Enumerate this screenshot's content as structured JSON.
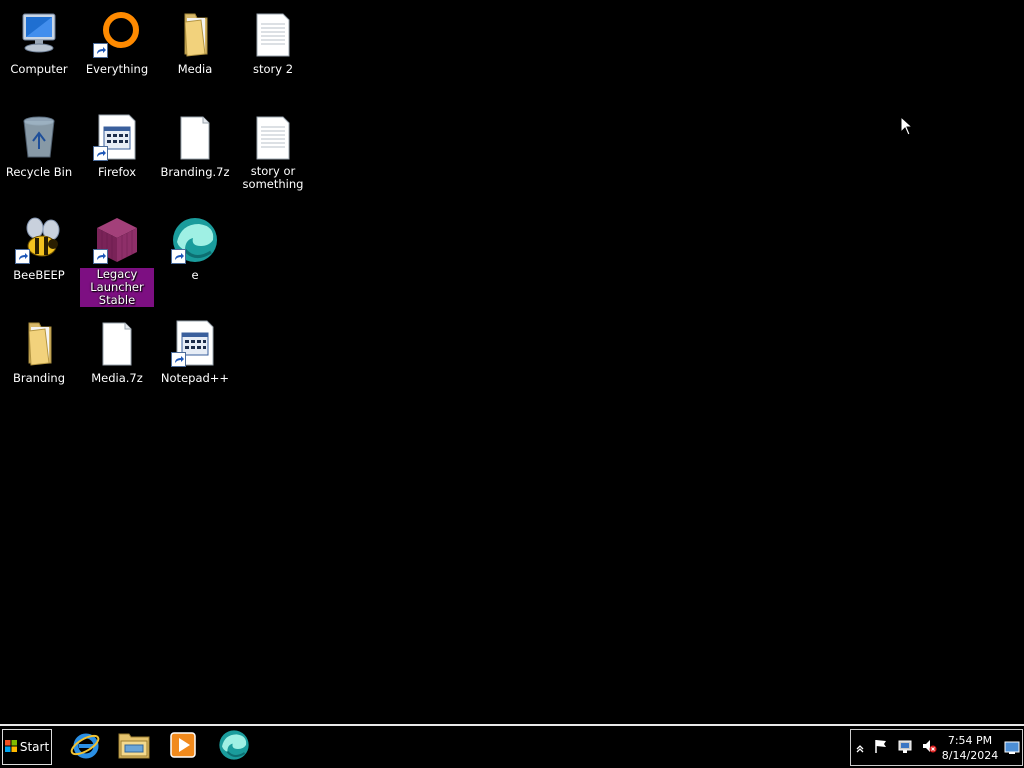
{
  "desktop": {
    "icons": [
      {
        "label": "Computer",
        "icon": "computer-icon"
      },
      {
        "label": "Everything",
        "icon": "everything-icon",
        "shortcut": true
      },
      {
        "label": "Media",
        "icon": "folder-icon"
      },
      {
        "label": "story 2",
        "icon": "text-document-icon"
      },
      {
        "label": "Recycle Bin",
        "icon": "recycle-bin-icon"
      },
      {
        "label": "Firefox",
        "icon": "firefox-app-icon",
        "shortcut": true
      },
      {
        "label": "Branding.7z",
        "icon": "blank-file-icon"
      },
      {
        "label": "story or something",
        "icon": "text-document-icon"
      },
      {
        "label": "BeeBEEP",
        "icon": "bee-icon",
        "shortcut": true
      },
      {
        "label": "Legacy Launcher Stable",
        "icon": "cube-icon",
        "shortcut": true,
        "selected": true
      },
      {
        "label": "e",
        "icon": "edge-icon",
        "shortcut": true
      },
      {
        "label": "Branding",
        "icon": "folder-icon"
      },
      {
        "label": "Media.7z",
        "icon": "blank-file-icon"
      },
      {
        "label": "Notepad++",
        "icon": "app-window-icon",
        "shortcut": true
      }
    ]
  },
  "taskbar": {
    "start_label": "Start",
    "pinned": [
      {
        "icon": "internet-explorer-icon"
      },
      {
        "icon": "file-explorer-icon"
      },
      {
        "icon": "media-player-icon"
      },
      {
        "icon": "edge-icon"
      }
    ],
    "tray": {
      "icons": [
        "show-hidden-icons-icon",
        "action-center-flag-icon",
        "network-icon",
        "volume-muted-icon"
      ],
      "time": "7:54 PM",
      "date": "8/14/2024"
    }
  },
  "colors": {
    "desktop": "#000000",
    "selection": "#7d0f82",
    "text": "#ffffff"
  }
}
